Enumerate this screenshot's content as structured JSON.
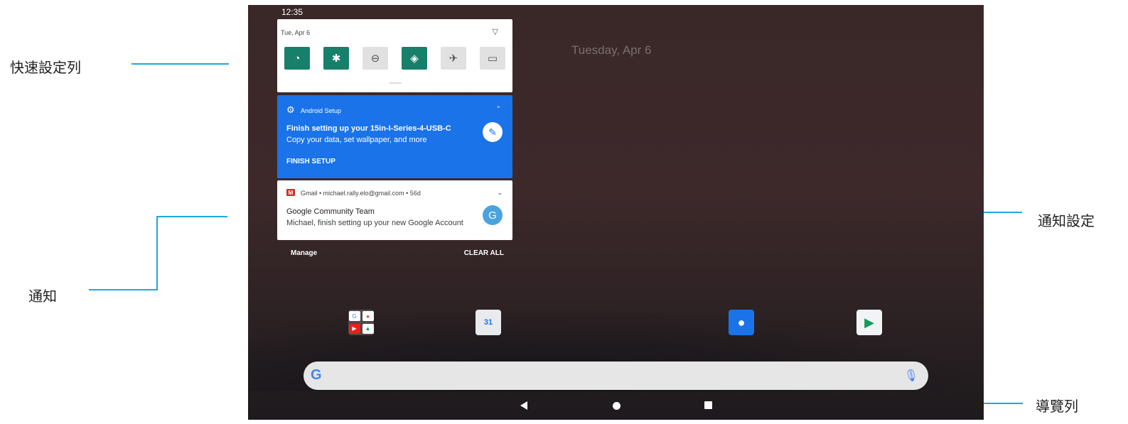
{
  "callouts": {
    "quick_settings": "快速設定列",
    "notifications": "通知",
    "notification_settings": "通知設定",
    "navigation_bar": "導覽列"
  },
  "status_bar": {
    "time": "12:35"
  },
  "home": {
    "date": "Tuesday, Apr 6"
  },
  "quick_settings": {
    "date": "Tue, Apr 6",
    "tiles": [
      {
        "name": "wifi",
        "glyph": "◔",
        "active": true
      },
      {
        "name": "bluetooth",
        "glyph": "✱",
        "active": true
      },
      {
        "name": "do-not-disturb",
        "glyph": "⊖",
        "active": false
      },
      {
        "name": "auto-rotate",
        "glyph": "◈",
        "active": true
      },
      {
        "name": "airplane-mode",
        "glyph": "✈",
        "active": false
      },
      {
        "name": "cast",
        "glyph": "▭",
        "active": false
      }
    ]
  },
  "notifications": {
    "setup": {
      "app": "Android Setup",
      "title": "Finish setting up your 15in-I-Series-4-USB-C",
      "body": "Copy your data, set wallpaper, and more",
      "action": "FINISH SETUP"
    },
    "gmail": {
      "icon_letter": "M",
      "header": "Gmail • michael.rally.elo@gmail.com • 56d",
      "title": "Google Community Team",
      "body": "Michael, finish setting up your new Google Account",
      "avatar_letter": "G"
    }
  },
  "shade_footer": {
    "manage": "Manage",
    "clear_all": "CLEAR ALL"
  },
  "home_icons": {
    "calendar_label": "31"
  },
  "search": {
    "logo": "G"
  },
  "colors": {
    "accent_blue": "#1a73e8",
    "tile_active": "#17806a",
    "callout_line": "#1ea7e0"
  }
}
